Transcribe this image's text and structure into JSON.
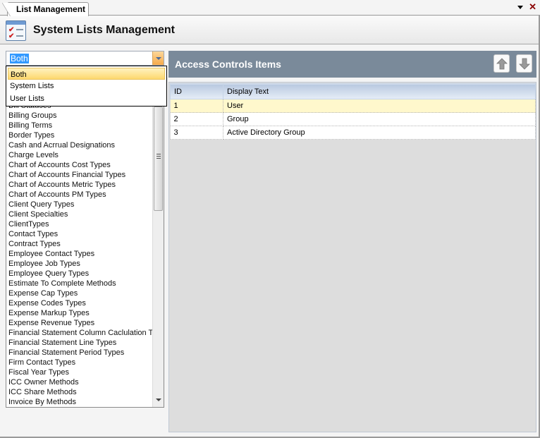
{
  "tab": {
    "label": "List Management",
    "menu_icon": "dropdown-triangle",
    "close_icon": "close-x"
  },
  "header": {
    "title": "System Lists Management",
    "icon": "checklist-icon"
  },
  "filter_combo": {
    "value": "Both",
    "options": [
      "Both",
      "System Lists",
      "User Lists"
    ],
    "highlighted_option": "Both"
  },
  "lists": {
    "items": [
      "Bill Statuses",
      "Billing Groups",
      "Billing Terms",
      "Border Types",
      "Cash and Acrrual Designations",
      "Charge Levels",
      "Chart of Accounts Cost Types",
      "Chart of Accounts Financial Types",
      "Chart of Accounts Metric Types",
      "Chart of Accounts PM Types",
      "Client Query Types",
      "Client Specialties",
      "ClientTypes",
      "Contact Types",
      "Contract Types",
      "Employee Contact Types",
      "Employee Job Types",
      "Employee Query Types",
      "Estimate To Complete Methods",
      "Expense Cap Types",
      "Expense Codes Types",
      "Expense Markup Types",
      "Expense Revenue Types",
      "Financial Statement Column Caclulation Types",
      "Financial Statement Line Types",
      "Financial Statement Period Types",
      "Firm Contact Types",
      "Fiscal Year Types",
      "ICC Owner Methods",
      "ICC Share Methods",
      "Invoice By Methods"
    ]
  },
  "items_panel": {
    "title": "Access Controls Items",
    "move_up_icon": "arrow-up",
    "move_down_icon": "arrow-down",
    "columns": [
      "ID",
      "Display Text"
    ],
    "rows": [
      {
        "id": "1",
        "text": "User"
      },
      {
        "id": "2",
        "text": "Group"
      },
      {
        "id": "3",
        "text": "Active Directory Group"
      }
    ],
    "selected_row": 0
  },
  "colors": {
    "panel_header": "#7a8a9a",
    "selected_row": "#fff8cc",
    "close_red": "#8b0000",
    "combo_accent": "#f5a94a"
  }
}
